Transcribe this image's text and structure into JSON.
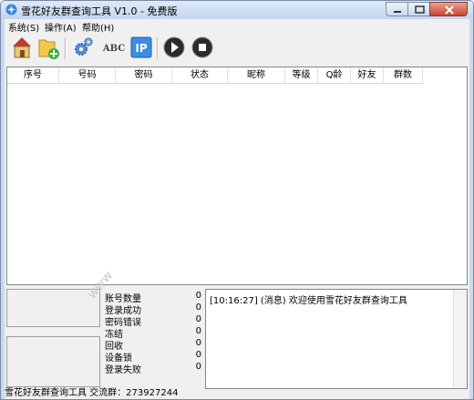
{
  "window": {
    "title": "雪花好友群查询工具 V1.0 - 免费版"
  },
  "menu": [
    {
      "label": "系统(S)"
    },
    {
      "label": "操作(A)"
    },
    {
      "label": "帮助(H)"
    }
  ],
  "toolbar": {
    "buttons": [
      {
        "icon": "home-icon"
      },
      {
        "icon": "add-folder-icon"
      },
      {
        "icon": "gears-icon"
      },
      {
        "icon": "abc-icon",
        "label": "ABC"
      },
      {
        "icon": "ip-icon",
        "label": "IP"
      },
      {
        "icon": "play-icon"
      },
      {
        "icon": "stop-icon"
      }
    ]
  },
  "table": {
    "columns": [
      "序号",
      "号码",
      "密码",
      "状态",
      "昵称",
      "等级",
      "Q龄",
      "好友",
      "群数"
    ],
    "rows": []
  },
  "stats": [
    {
      "label": "账号数量",
      "value": "0"
    },
    {
      "label": "登录成功",
      "value": "0"
    },
    {
      "label": "密码错误",
      "value": "0"
    },
    {
      "label": "冻结",
      "value": "0"
    },
    {
      "label": "回收",
      "value": "0"
    },
    {
      "label": "设备锁",
      "value": "0"
    },
    {
      "label": "登录失败",
      "value": "0"
    }
  ],
  "log": {
    "lines": [
      "[10:16:27] (消息) 欢迎使用雪花好友群查询工具"
    ]
  },
  "status": {
    "text": "雪花好友群查询工具 交流群：273927244"
  },
  "watermark": {
    "text": "www"
  }
}
